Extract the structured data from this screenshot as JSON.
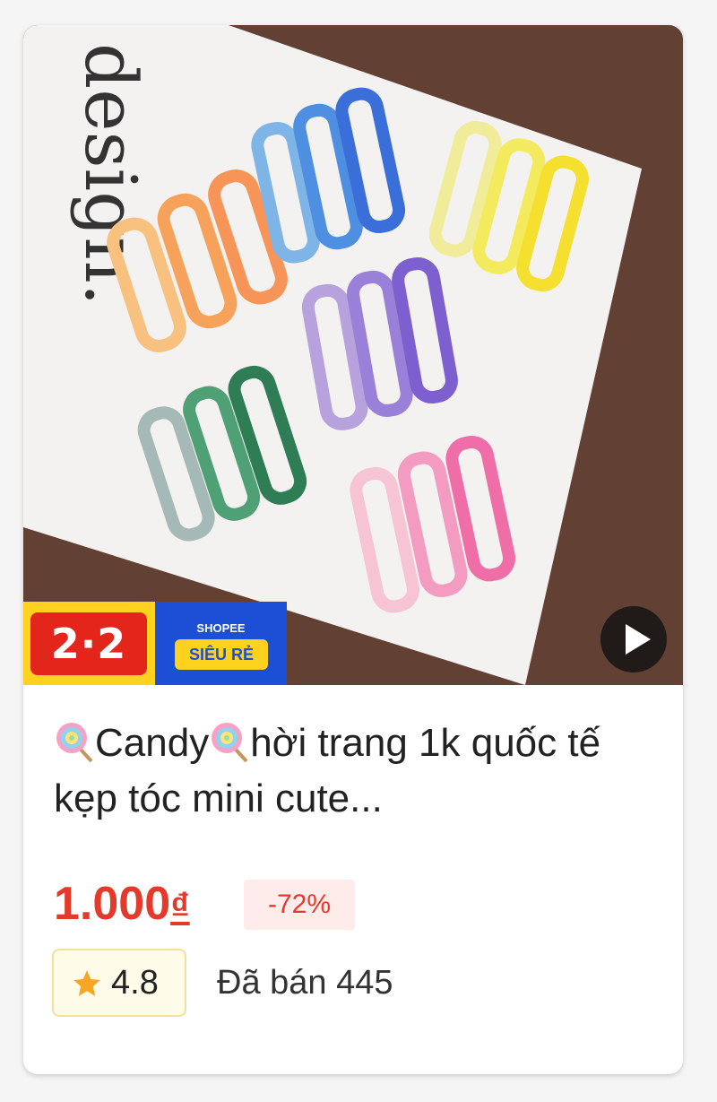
{
  "product": {
    "title_part1": "Candy",
    "title_part2": "hời trang 1k quốc tế kẹp tóc mini cute...",
    "price": "1.000",
    "currency": "₫",
    "discount": "-72%",
    "rating": "4.8",
    "sold": "Đã bán 445"
  },
  "badges": {
    "campaign": "2·2",
    "shopee_small": "SHOPEE",
    "shopee_big": "SIÊU RẺ"
  },
  "photo": {
    "paper_text": "design."
  },
  "colors": {
    "price_red": "#e33a2b",
    "badge_yellow": "#ffd21f",
    "badge_red": "#e4251b",
    "badge_blue": "#1d4fd6",
    "star": "#f6a623"
  },
  "icons": {
    "lollipop": "lollipop-icon",
    "play": "play-icon",
    "star": "star-icon"
  }
}
